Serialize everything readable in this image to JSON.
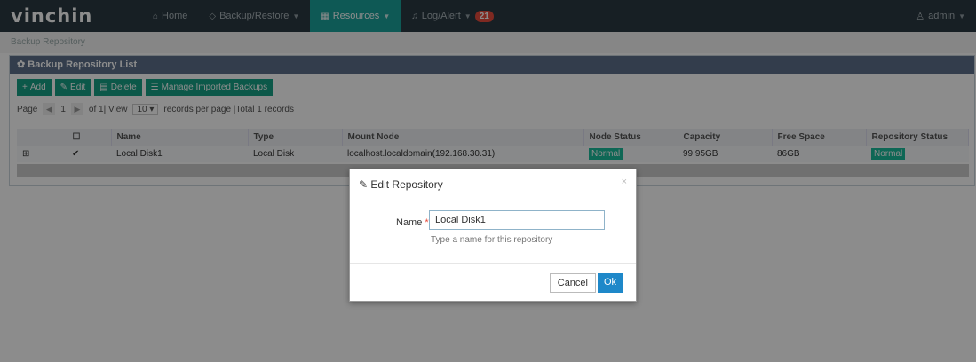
{
  "app": {
    "logo": "vinchin"
  },
  "nav": {
    "items": [
      {
        "icon": "⌂",
        "label": "Home"
      },
      {
        "icon": "◇",
        "label": "Backup/Restore"
      },
      {
        "icon": "▦",
        "label": "Resources"
      },
      {
        "icon": "♫",
        "label": "Log/Alert"
      }
    ],
    "alert_count": "21",
    "user": "admin",
    "user_icon": "♙"
  },
  "breadcrumb": "Backup Repository",
  "panel": {
    "title": "Backup Repository List",
    "buttons": {
      "add": "Add",
      "edit": "Edit",
      "delete": "Delete",
      "manage": "Manage Imported Backups"
    },
    "pager": {
      "page_label": "Page",
      "page": "1",
      "of_text": "of 1| View",
      "per_page": "10",
      "records_text": "records per page |Total 1 records"
    }
  },
  "table": {
    "headers": [
      "Name",
      "Type",
      "Mount Node",
      "Node Status",
      "Capacity",
      "Free Space",
      "Repository Status"
    ],
    "rows": [
      {
        "name": "Local Disk1",
        "type": "Local Disk",
        "mount": "localhost.localdomain(192.168.30.31)",
        "node_status": "Normal",
        "capacity": "99.95GB",
        "free": "86GB",
        "repo_status": "Normal"
      }
    ]
  },
  "modal": {
    "title": "Edit Repository",
    "name_label": "Name",
    "required_mark": "*",
    "name_value": "Local Disk1",
    "name_help": "Type a name for this repository",
    "cancel": "Cancel",
    "ok": "Ok",
    "close": "×"
  }
}
